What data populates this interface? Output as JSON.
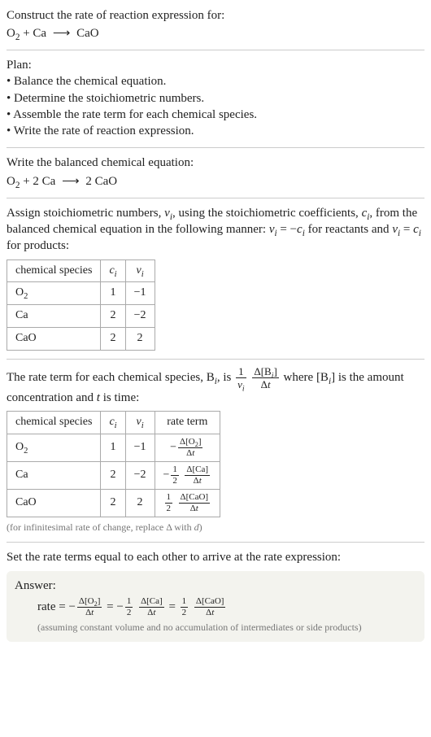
{
  "intro": {
    "prompt": "Construct the rate of reaction expression for:",
    "equation_html": "O<sub>2</sub> + Ca <span class=\"arrow\">⟶</span> CaO"
  },
  "plan": {
    "title": "Plan:",
    "items": [
      "• Balance the chemical equation.",
      "• Determine the stoichiometric numbers.",
      "• Assemble the rate term for each chemical species.",
      "• Write the rate of reaction expression."
    ]
  },
  "balanced": {
    "title": "Write the balanced chemical equation:",
    "equation_html": "O<sub>2</sub> + 2 Ca <span class=\"arrow\">⟶</span> 2 CaO"
  },
  "stoich": {
    "text_html": "Assign stoichiometric numbers, <span class=\"italic\">ν<sub>i</sub></span>, using the stoichiometric coefficients, <span class=\"italic\">c<sub>i</sub></span>, from the balanced chemical equation in the following manner: <span class=\"italic\">ν<sub>i</sub></span> = −<span class=\"italic\">c<sub>i</sub></span> for reactants and <span class=\"italic\">ν<sub>i</sub></span> = <span class=\"italic\">c<sub>i</sub></span> for products:",
    "headers": {
      "species": "chemical species",
      "ci_html": "<span class=\"italic\">c<sub>i</sub></span>",
      "vi_html": "<span class=\"italic\">ν<sub>i</sub></span>"
    },
    "rows": [
      {
        "species_html": "O<sub>2</sub>",
        "ci": "1",
        "vi": "−1"
      },
      {
        "species_html": "Ca",
        "ci": "2",
        "vi": "−2"
      },
      {
        "species_html": "CaO",
        "ci": "2",
        "vi": "2"
      }
    ]
  },
  "rateterm": {
    "text_pre": "The rate term for each chemical species, B",
    "text_mid": ", is ",
    "frac1_num_html": "1",
    "frac1_den_html": "<span class=\"italic\">ν<sub>i</sub></span>",
    "frac2_num_html": "Δ[B<sub><span class=\"italic\">i</span></sub>]",
    "frac2_den_html": "Δ<span class=\"italic\">t</span>",
    "text_post_html": " where [B<sub><span class=\"italic\">i</span></sub>] is the amount concentration and <span class=\"italic\">t</span> is time:",
    "headers": {
      "species": "chemical species",
      "ci_html": "<span class=\"italic\">c<sub>i</sub></span>",
      "vi_html": "<span class=\"italic\">ν<sub>i</sub></span>",
      "rate": "rate term"
    },
    "rows": [
      {
        "species_html": "O<sub>2</sub>",
        "ci": "1",
        "vi": "−1",
        "rate_html": "−<span class=\"frac\"><span class=\"num\">Δ[O<sub>2</sub>]</span><span class=\"den\">Δ<span class=\"italic\">t</span></span></span>"
      },
      {
        "species_html": "Ca",
        "ci": "2",
        "vi": "−2",
        "rate_html": "−<span class=\"frac\"><span class=\"num\">1</span><span class=\"den\">2</span></span> <span class=\"frac\"><span class=\"num\">Δ[Ca]</span><span class=\"den\">Δ<span class=\"italic\">t</span></span></span>"
      },
      {
        "species_html": "CaO",
        "ci": "2",
        "vi": "2",
        "rate_html": "<span class=\"frac\"><span class=\"num\">1</span><span class=\"den\">2</span></span> <span class=\"frac\"><span class=\"num\">Δ[CaO]</span><span class=\"den\">Δ<span class=\"italic\">t</span></span></span>"
      }
    ],
    "footnote_html": "(for infinitesimal rate of change, replace Δ with <span class=\"italic\">d</span>)"
  },
  "final": {
    "title": "Set the rate terms equal to each other to arrive at the rate expression:",
    "answer_label": "Answer:",
    "answer_html": "rate = −<span class=\"frac\"><span class=\"num\">Δ[O<sub>2</sub>]</span><span class=\"den\">Δ<span class=\"italic\">t</span></span></span> = −<span class=\"frac\"><span class=\"num\">1</span><span class=\"den\">2</span></span> <span class=\"frac\"><span class=\"num\">Δ[Ca]</span><span class=\"den\">Δ<span class=\"italic\">t</span></span></span> = <span class=\"frac\"><span class=\"num\">1</span><span class=\"den\">2</span></span> <span class=\"frac\"><span class=\"num\">Δ[CaO]</span><span class=\"den\">Δ<span class=\"italic\">t</span></span></span>",
    "answer_note": "(assuming constant volume and no accumulation of intermediates or side products)"
  }
}
